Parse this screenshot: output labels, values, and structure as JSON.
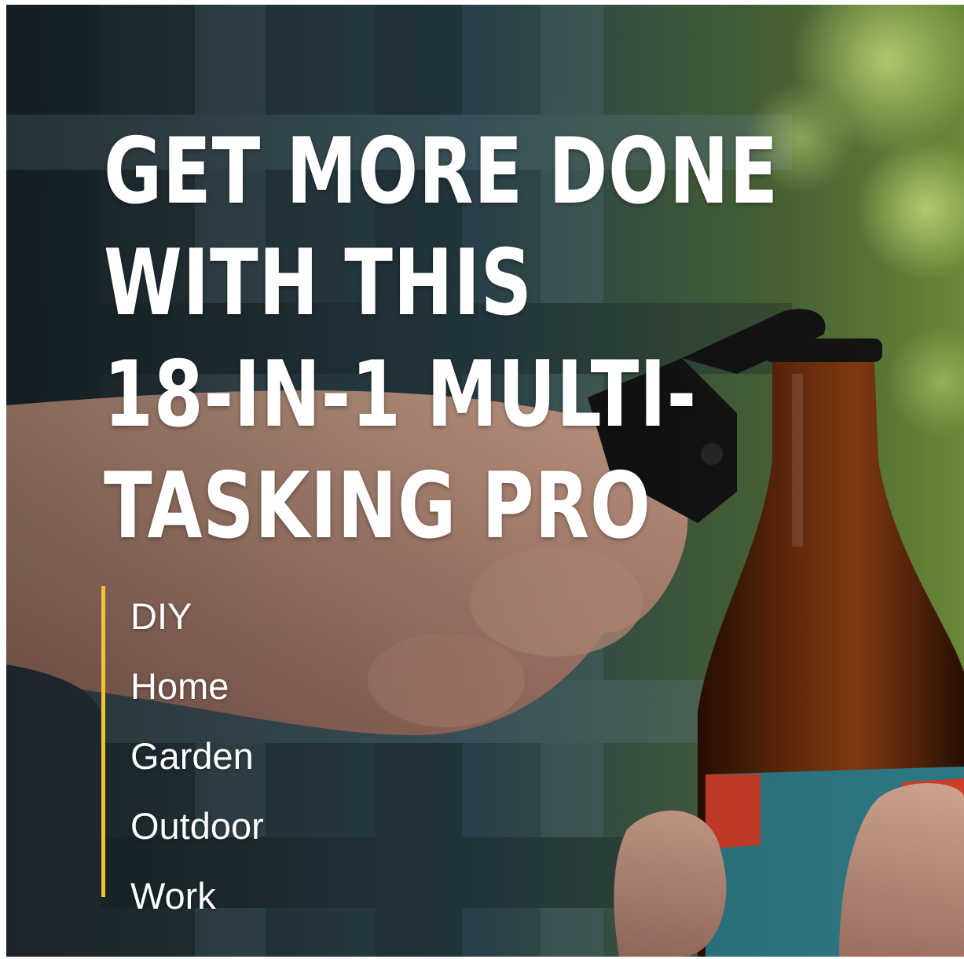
{
  "headline": {
    "line1": "GET MORE DONE",
    "line2": "WITH THIS",
    "line3": "18-IN-1 MULTI-",
    "line4": "TASKING PRO"
  },
  "uses": [
    "DIY",
    "Home",
    "Garden",
    "Outdoor",
    "Work"
  ],
  "colors": {
    "accent": "#f2c230",
    "text": "#ffffff",
    "bottle": "#4a1e08",
    "label_red": "#d8402c",
    "label_teal": "#2f7f8c"
  },
  "photo": {
    "subject": "hand-opening-beer-bottle-with-multitool-photo"
  }
}
